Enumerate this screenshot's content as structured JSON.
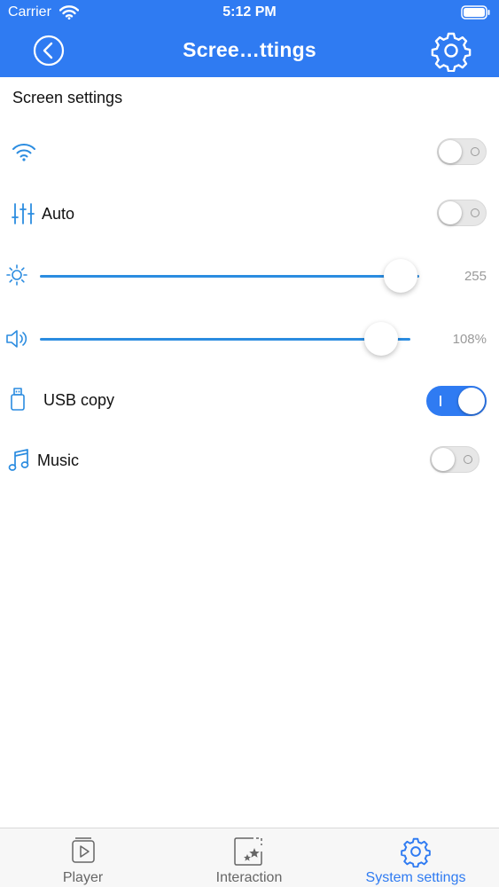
{
  "status_bar": {
    "carrier": "Carrier",
    "time": "5:12 PM"
  },
  "nav": {
    "title": "Scree…ttings",
    "back_icon": "chevron-left-circle-icon",
    "settings_icon": "gear-icon"
  },
  "section_title": "Screen settings",
  "rows": {
    "wifi": {
      "icon": "wifi-icon",
      "label": "",
      "on": false
    },
    "auto": {
      "icon": "equalizer-icon",
      "label": "Auto",
      "on": false
    },
    "brightness": {
      "icon": "sun-icon",
      "value": 255,
      "display": "255",
      "fraction": 0.95
    },
    "volume": {
      "icon": "speaker-icon",
      "value": 108,
      "display": "108%",
      "fraction": 0.92
    },
    "usb_copy": {
      "icon": "usb-drive-icon",
      "label": "USB copy",
      "on": true
    },
    "music": {
      "icon": "music-note-icon",
      "label": "Music",
      "on": false
    }
  },
  "tabs": [
    {
      "label": "Player",
      "icon": "play-icon",
      "active": false
    },
    {
      "label": "Interaction",
      "icon": "stars-icon",
      "active": false
    },
    {
      "label": "System settings",
      "icon": "gear-icon",
      "active": true
    }
  ],
  "colors": {
    "accent": "#2f7bf2",
    "slider": "#2b8ce0",
    "muted_text": "#9a9a9a"
  }
}
